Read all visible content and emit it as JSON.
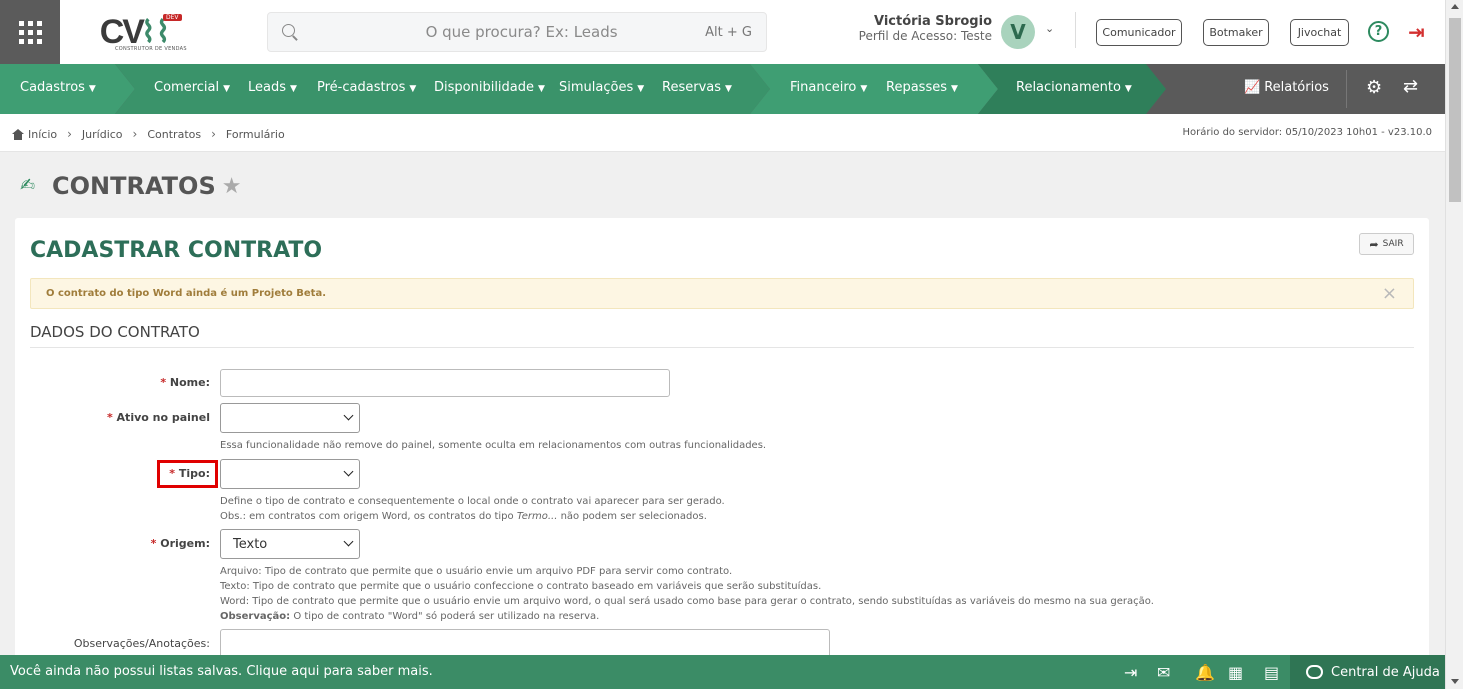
{
  "header": {
    "logo_text": "CV",
    "logo_badge": "DEV",
    "logo_sub": "CONSTRUTOR DE VENDAS",
    "search_placeholder": "O que procura? Ex: Leads",
    "search_shortcut": "Alt + G",
    "user_name": "Victória Sbrogio",
    "user_profile": "Perfil de Acesso: Teste",
    "avatar_initial": "V",
    "buttons": [
      "Comunicador",
      "Botmaker",
      "Jivochat"
    ]
  },
  "nav": {
    "items": [
      "Cadastros",
      "Comercial",
      "Leads",
      "Pré-cadastros",
      "Disponibilidade",
      "Simulações",
      "Reservas",
      "Financeiro",
      "Repasses",
      "Relacionamento"
    ],
    "reports": "Relatórios"
  },
  "breadcrumb": {
    "items": [
      "Início",
      "Jurídico",
      "Contratos",
      "Formulário"
    ],
    "server_time": "Horário do servidor: 05/10/2023 10h01 - v23.10.0"
  },
  "page": {
    "title": "CONTRATOS",
    "panel_title": "CADASTRAR CONTRATO",
    "exit_label": "SAIR",
    "alert": "O contrato do tipo Word ainda é um Projeto Beta.",
    "section": "DADOS DO CONTRATO"
  },
  "form": {
    "nome_label": "Nome:",
    "ativo_label": "Ativo no painel",
    "ativo_help": "Essa funcionalidade não remove do painel, somente oculta em relacionamentos com outras funcionalidades.",
    "tipo_label": "Tipo:",
    "tipo_help1": "Define o tipo de contrato e consequentemente o local onde o contrato vai aparecer para ser gerado.",
    "tipo_help2_pre": "Obs.: em contratos com origem Word, os contratos do tipo ",
    "tipo_help2_em": "Termo...",
    "tipo_help2_post": " não podem ser selecionados.",
    "origem_label": "Origem:",
    "origem_value": "Texto",
    "origem_help1": "Arquivo: Tipo de contrato que permite que o usuário envie um arquivo PDF para servir como contrato.",
    "origem_help2": "Texto: Tipo de contrato que permite que o usuário confeccione o contrato baseado em variáveis que serão substituídas.",
    "origem_help3": "Word: Tipo de contrato que permite que o usuário envie um arquivo word, o qual será usado como base para gerar o contrato, sendo substituídas as variáveis do mesmo na sua geração.",
    "origem_help4_bold": "Observação:",
    "origem_help4": " O tipo de contrato \"Word\" só poderá ser utilizado na reserva.",
    "obs_label": "Observações/Anotações:"
  },
  "bottombar": {
    "message": "Você ainda não possui listas salvas. Clique aqui para saber mais.",
    "help_center": "Central de Ajuda"
  }
}
